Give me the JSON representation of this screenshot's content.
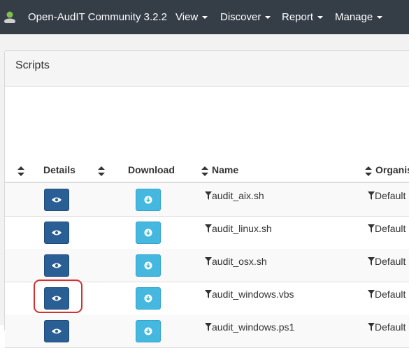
{
  "brand": {
    "title": "Open-AudIT Community 3.2.2"
  },
  "nav": [
    {
      "label": "View"
    },
    {
      "label": "Discover"
    },
    {
      "label": "Report"
    },
    {
      "label": "Manage"
    }
  ],
  "panel": {
    "title": "Scripts"
  },
  "table": {
    "headers": {
      "details": "Details",
      "download": "Download",
      "name": "Name",
      "organisation": "Organis"
    },
    "rows": [
      {
        "name": "audit_aix.sh",
        "org": "Default"
      },
      {
        "name": "audit_linux.sh",
        "org": "Default"
      },
      {
        "name": "audit_osx.sh",
        "org": "Default"
      },
      {
        "name": "audit_windows.vbs",
        "org": "Default"
      },
      {
        "name": "audit_windows.ps1",
        "org": "Default"
      }
    ]
  },
  "icons": {
    "logo": "person-icon",
    "details": "eye-icon",
    "download": "download-icon",
    "sort": "sort-icon",
    "filter": "filter-icon"
  },
  "colors": {
    "navbar": "#353d47",
    "details_button": "#2a5f96",
    "download_button": "#45b8e0",
    "highlight": "#d3302f"
  }
}
